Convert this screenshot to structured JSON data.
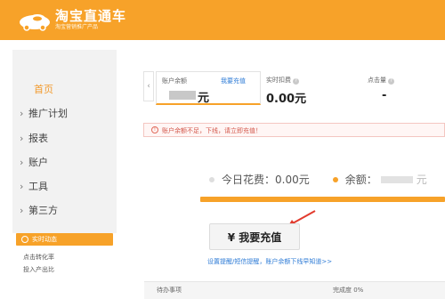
{
  "brand": {
    "title": "淘宝直通车",
    "subtitle": "淘宝营销推广产品"
  },
  "colors": {
    "brand_orange": "#f7a229",
    "link_blue": "#2d7bd6",
    "warning_red": "#d2574a"
  },
  "sidebar": {
    "items": [
      {
        "label": "首页",
        "active": true
      },
      {
        "label": "推广计划"
      },
      {
        "label": "报表"
      },
      {
        "label": "账户"
      },
      {
        "label": "工具"
      },
      {
        "label": "第三方"
      }
    ],
    "live": {
      "title": "实时动态",
      "lines": [
        "点击转化率",
        "投入产出比"
      ]
    }
  },
  "account": {
    "balance_label": "账户余额",
    "recharge_link": "我要充值",
    "balance_unit": "元",
    "deduction_label": "实时扣费",
    "deduction_value": "0.00元",
    "clicks_label": "点击量",
    "clicks_value": "-"
  },
  "warning": {
    "text": "账户余额不足，下线，请立即充值！"
  },
  "spend": {
    "today_label": "今日花费：",
    "today_value": "0.00元",
    "balance_label": "余额：",
    "balance_unit": "元"
  },
  "actions": {
    "recharge_button": "¥ 我要充值",
    "help_link": "设置提醒/短信提醒，账户余额下线早知道>>"
  },
  "bottom": {
    "left": "待办事项",
    "right": "完成度 0%"
  },
  "icons": {
    "logo": "car-logo-icon",
    "prev": "chevron-left-icon",
    "help": "question-circle-icon",
    "warn": "exclamation-circle-icon",
    "arrow": "red-arrow-icon"
  }
}
